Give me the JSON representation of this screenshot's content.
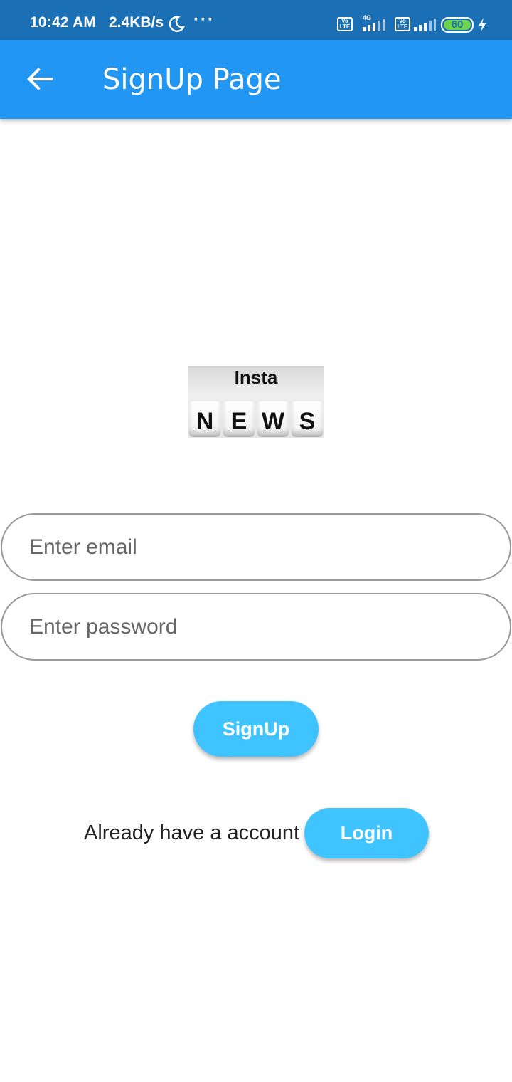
{
  "status_bar": {
    "time": "10:42 AM",
    "speed": "2.4KB/s",
    "more": "···",
    "volte": "Vo LTE",
    "network": "4G",
    "battery": "60",
    "icons": [
      "moon-icon",
      "volte-icon",
      "signal-icon",
      "battery-icon",
      "charging-icon"
    ]
  },
  "app_bar": {
    "title": "SignUp Page",
    "back_icon": "arrow-left-icon",
    "color": "#2196f3"
  },
  "logo": {
    "top_text": "Insta",
    "letters": [
      "N",
      "E",
      "W",
      "S"
    ]
  },
  "form": {
    "email_placeholder": "Enter email",
    "password_placeholder": "Enter password",
    "signup_label": "SignUp"
  },
  "footer": {
    "prompt": "Already have a account",
    "login_label": "Login"
  },
  "colors": {
    "status_bar": "#1b6fb5",
    "button": "#40c4ff"
  }
}
